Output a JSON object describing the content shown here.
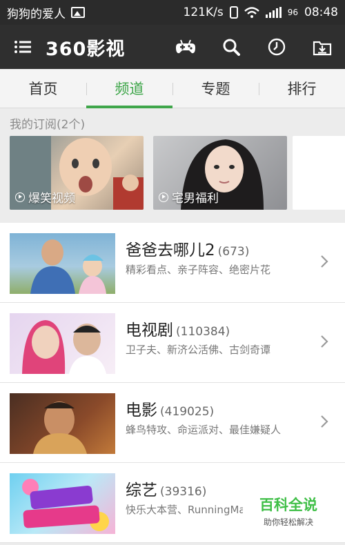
{
  "status_bar": {
    "app_name": "狗狗的爱人",
    "speed": "121K/s",
    "battery": "96",
    "time": "08:48"
  },
  "app_bar": {
    "logo": "360影视"
  },
  "tabs": [
    {
      "label": "首页",
      "active": false
    },
    {
      "label": "频道",
      "active": true
    },
    {
      "label": "专题",
      "active": false
    },
    {
      "label": "排行",
      "active": false
    }
  ],
  "subscriptions": {
    "title": "我的订阅(2个)",
    "items": [
      {
        "label": "爆笑视频"
      },
      {
        "label": "宅男福利"
      }
    ]
  },
  "channels": [
    {
      "title": "爸爸去哪儿2",
      "count": "(673)",
      "desc": "精彩看点、亲子阵容、绝密片花"
    },
    {
      "title": "电视剧",
      "count": "(110384)",
      "desc": "卫子夫、新济公活佛、古剑奇谭"
    },
    {
      "title": "电影",
      "count": "(419025)",
      "desc": "蜂鸟特攻、命运派对、最佳嫌疑人"
    },
    {
      "title": "综艺",
      "count": "(39316)",
      "desc": "快乐大本营、RunningMan"
    }
  ],
  "watermark": {
    "line1": "百科全说",
    "line2": "助你轻松解决"
  },
  "colors": {
    "accent": "#3fa64a",
    "appbar": "#2f2f2f",
    "statusbar": "#2b2b2b"
  }
}
